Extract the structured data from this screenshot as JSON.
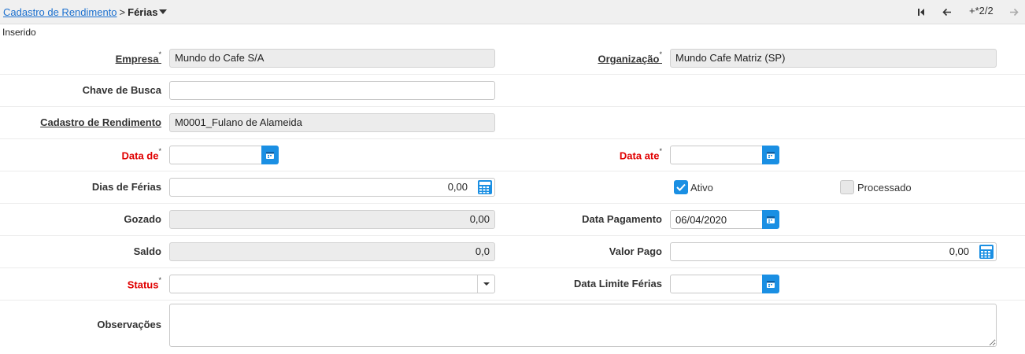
{
  "breadcrumb": {
    "parent": "Cadastro de Rendimento",
    "separator": ">",
    "current": "Férias"
  },
  "nav": {
    "record_counter": "+*2/2",
    "first_icon": "skip-to-first-icon",
    "prev_icon": "arrow-left-icon",
    "next_icon": "arrow-right-icon"
  },
  "status_text": "Inserido",
  "form": {
    "empresa": {
      "label": "Empresa",
      "required_mark": "*",
      "value": "Mundo do Cafe S/A"
    },
    "organizacao": {
      "label": "Organização",
      "required_mark": "*",
      "value": "Mundo Cafe Matriz (SP)"
    },
    "chave_busca": {
      "label": "Chave de Busca",
      "value": ""
    },
    "cadastro_rendimento": {
      "label": "Cadastro de Rendimento",
      "value": "M0001_Fulano de Alameida"
    },
    "data_de": {
      "label": "Data de",
      "required_mark": "*",
      "value": ""
    },
    "data_ate": {
      "label": "Data ate",
      "required_mark": "*",
      "value": ""
    },
    "dias_ferias": {
      "label": "Dias de Férias",
      "value": "0,00"
    },
    "ativo": {
      "label": "Ativo",
      "checked": true
    },
    "processado": {
      "label": "Processado",
      "checked": false
    },
    "gozado": {
      "label": "Gozado",
      "value": "0,00"
    },
    "data_pagamento": {
      "label": "Data Pagamento",
      "value": "06/04/2020"
    },
    "saldo": {
      "label": "Saldo",
      "value": "0,0"
    },
    "valor_pago": {
      "label": "Valor Pago",
      "value": "0,00"
    },
    "status": {
      "label": "Status",
      "required_mark": "*",
      "value": ""
    },
    "data_limite_ferias": {
      "label": "Data Limite Férias",
      "value": ""
    },
    "observacoes": {
      "label": "Observações",
      "value": ""
    }
  },
  "colors": {
    "accent": "#1a8fe3",
    "required_label": "#e00000",
    "link": "#1a6fcf"
  }
}
